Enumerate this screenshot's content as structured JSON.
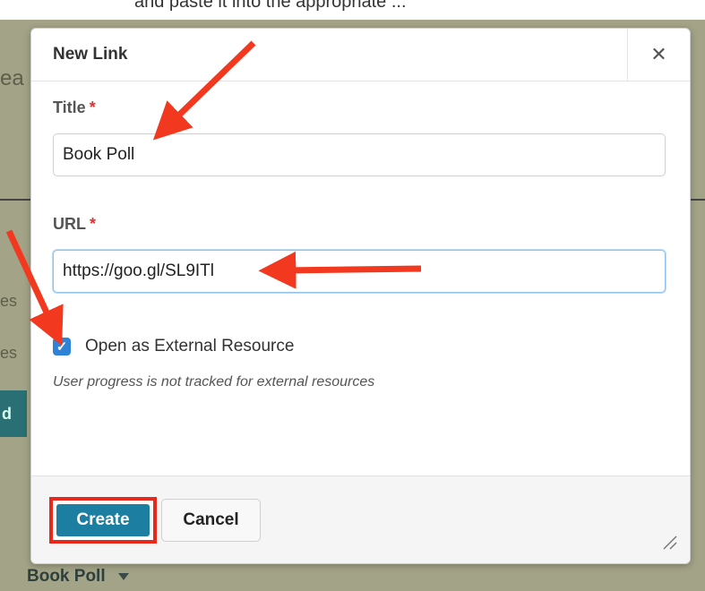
{
  "background": {
    "top_text": "and paste it into the appropriate ...",
    "fragments": [
      "ea",
      "es",
      "es",
      "d"
    ],
    "bottom_item_label": "Book Poll"
  },
  "dialog": {
    "title": "New Link",
    "close_icon": "close-icon",
    "title_field": {
      "label": "Title",
      "required_mark": "*",
      "value": "Book Poll"
    },
    "url_field": {
      "label": "URL",
      "required_mark": "*",
      "value": "https://goo.gl/SL9ITl"
    },
    "external_checkbox": {
      "checked": true,
      "label": "Open as External Resource"
    },
    "hint": "User progress is not tracked for external resources",
    "buttons": {
      "create": "Create",
      "cancel": "Cancel"
    }
  },
  "colors": {
    "accent": "#1c7fa1",
    "highlight": "#e8281b",
    "checkbox": "#2e83d6"
  }
}
